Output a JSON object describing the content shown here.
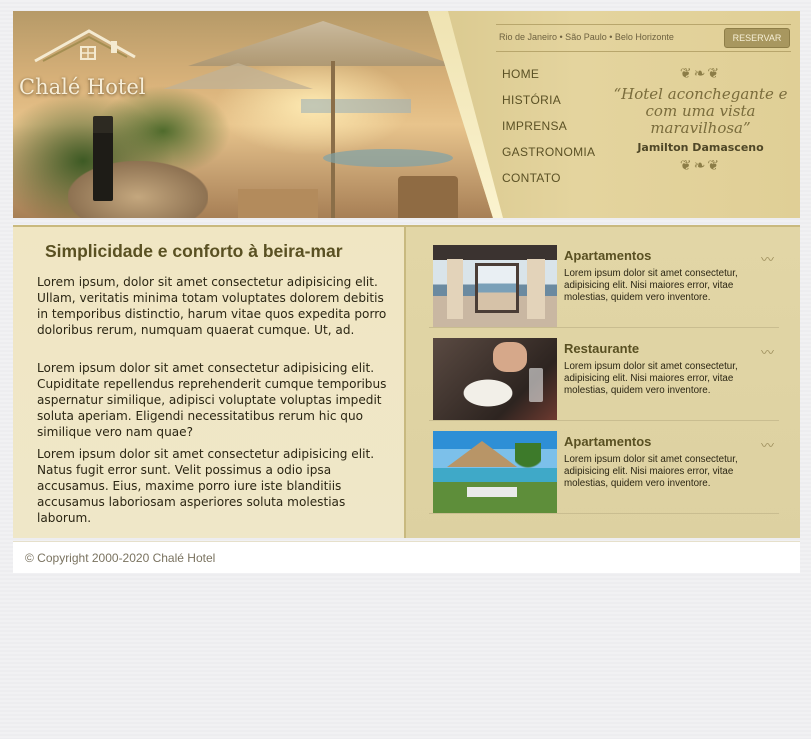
{
  "header": {
    "logo_text": "Chalé Hotel",
    "cities": "Rio de Janeiro • São Paulo • Belo Horizonte",
    "reserve_label": "RESERVAR",
    "nav": [
      {
        "label": "HOME"
      },
      {
        "label": "HISTÓRIA"
      },
      {
        "label": "IMPRENSA"
      },
      {
        "label": "GASTRONOMIA"
      },
      {
        "label": "CONTATO"
      }
    ],
    "quote": "“Hotel aconchegante e com uma vista maravilhosa”",
    "quote_author": "Jamilton Damasceno",
    "colors": {
      "accent": "#a8975f",
      "panel": "#e0cf96",
      "title": "#595022"
    }
  },
  "main": {
    "title": "Simplicidade e conforto à beira-mar",
    "paragraphs": [
      "Lorem ipsum, dolor sit amet consectetur adipisicing elit. Ullam, veritatis minima totam voluptates dolorem debitis in temporibus distinctio, harum vitae quos expedita porro doloribus rerum, numquam quaerat cumque. Ut, ad.",
      "Lorem ipsum dolor sit amet consectetur adipisicing elit. Cupiditate repellendus reprehenderit cumque temporibus aspernatur similique, adipisci voluptate voluptas impedit soluta aperiam. Eligendi necessitatibus rerum hic quo similique vero nam quae?",
      "Lorem ipsum dolor sit amet consectetur adipisicing elit. Natus fugit error sunt. Velit possimus a odio ipsa accusamus. Eius, maxime porro iure iste blanditiis accusamus laboriosam asperiores soluta molestias laborum."
    ]
  },
  "features": [
    {
      "title": "Apartamentos",
      "icon": "wave-icon",
      "description": "Lorem ipsum dolor sit amet consectetur, adipisicing elit. Nisi maiores error, vitae molestias, quidem vero inventore."
    },
    {
      "title": "Restaurante",
      "icon": "wave-icon",
      "description": "Lorem ipsum dolor sit amet consectetur, adipisicing elit. Nisi maiores error, vitae molestias, quidem vero inventore."
    },
    {
      "title": "Apartamentos",
      "icon": "wave-icon",
      "description": "Lorem ipsum dolor sit amet consectetur, adipisicing elit. Nisi maiores error, vitae molestias, quidem vero inventore."
    }
  ],
  "footer": {
    "copyright": "© Copyright 2000-2020 Chalé Hotel"
  }
}
